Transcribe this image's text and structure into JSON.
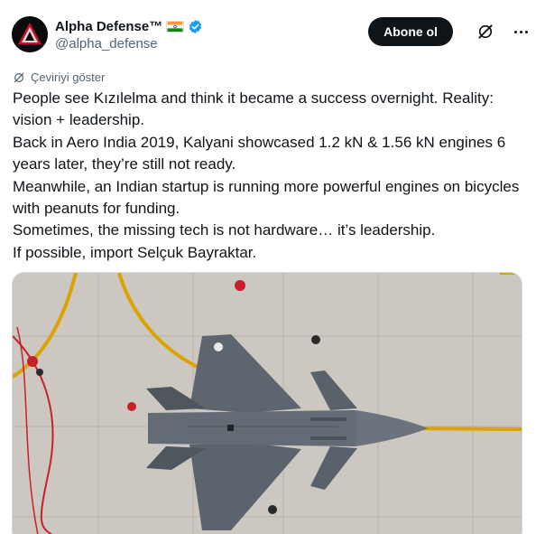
{
  "author": {
    "display_name": "Alpha Defense™",
    "handle": "@alpha_defense",
    "verified": true,
    "avatar_icon": "alpha-logo-icon",
    "flag_icon": "india-flag-icon"
  },
  "actions": {
    "follow_label": "Abone ol",
    "grok_icon": "grok-icon",
    "more_icon": "more-options-icon"
  },
  "translate_label": "Çeviriyi göster",
  "tweet": {
    "lines": [
      "People see Kızılelma and think it became a success overnight. Reality: vision + leadership.",
      "Back in Aero India 2019, Kalyani showcased 1.2 kN & 1.56 kN engines 6 years later, they’re still not ready.",
      "Meanwhile, an Indian startup is running more powerful engines on bicycles with peanuts for funding.",
      "Sometimes, the missing tech is not hardware… it’s leadership.",
      "If possible, import Selçuk Bayraktar."
    ]
  },
  "media": {
    "description_icon": "fighter-jet-photo"
  },
  "colors": {
    "text": "#0f1419",
    "secondary": "#536471",
    "verified": "#1d9bf0",
    "follow_bg": "#0f1419"
  }
}
